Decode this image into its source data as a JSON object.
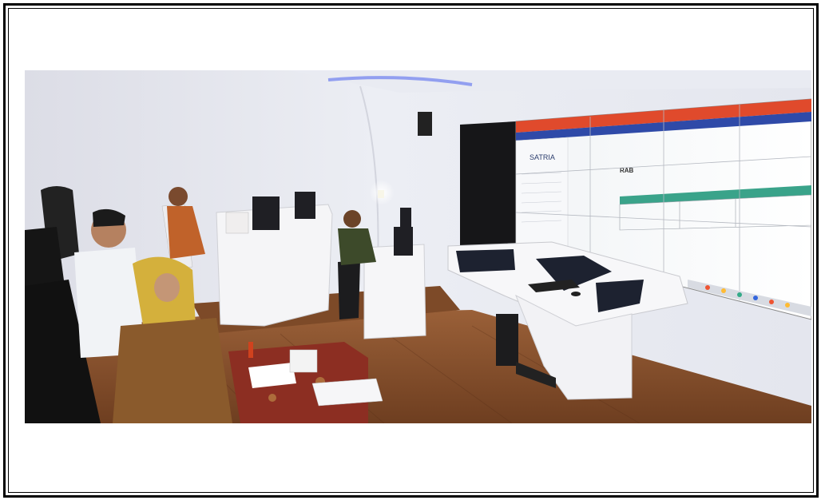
{
  "photo": {
    "screen": {
      "app_name": "SATRIA",
      "page_label": "RAB"
    }
  }
}
